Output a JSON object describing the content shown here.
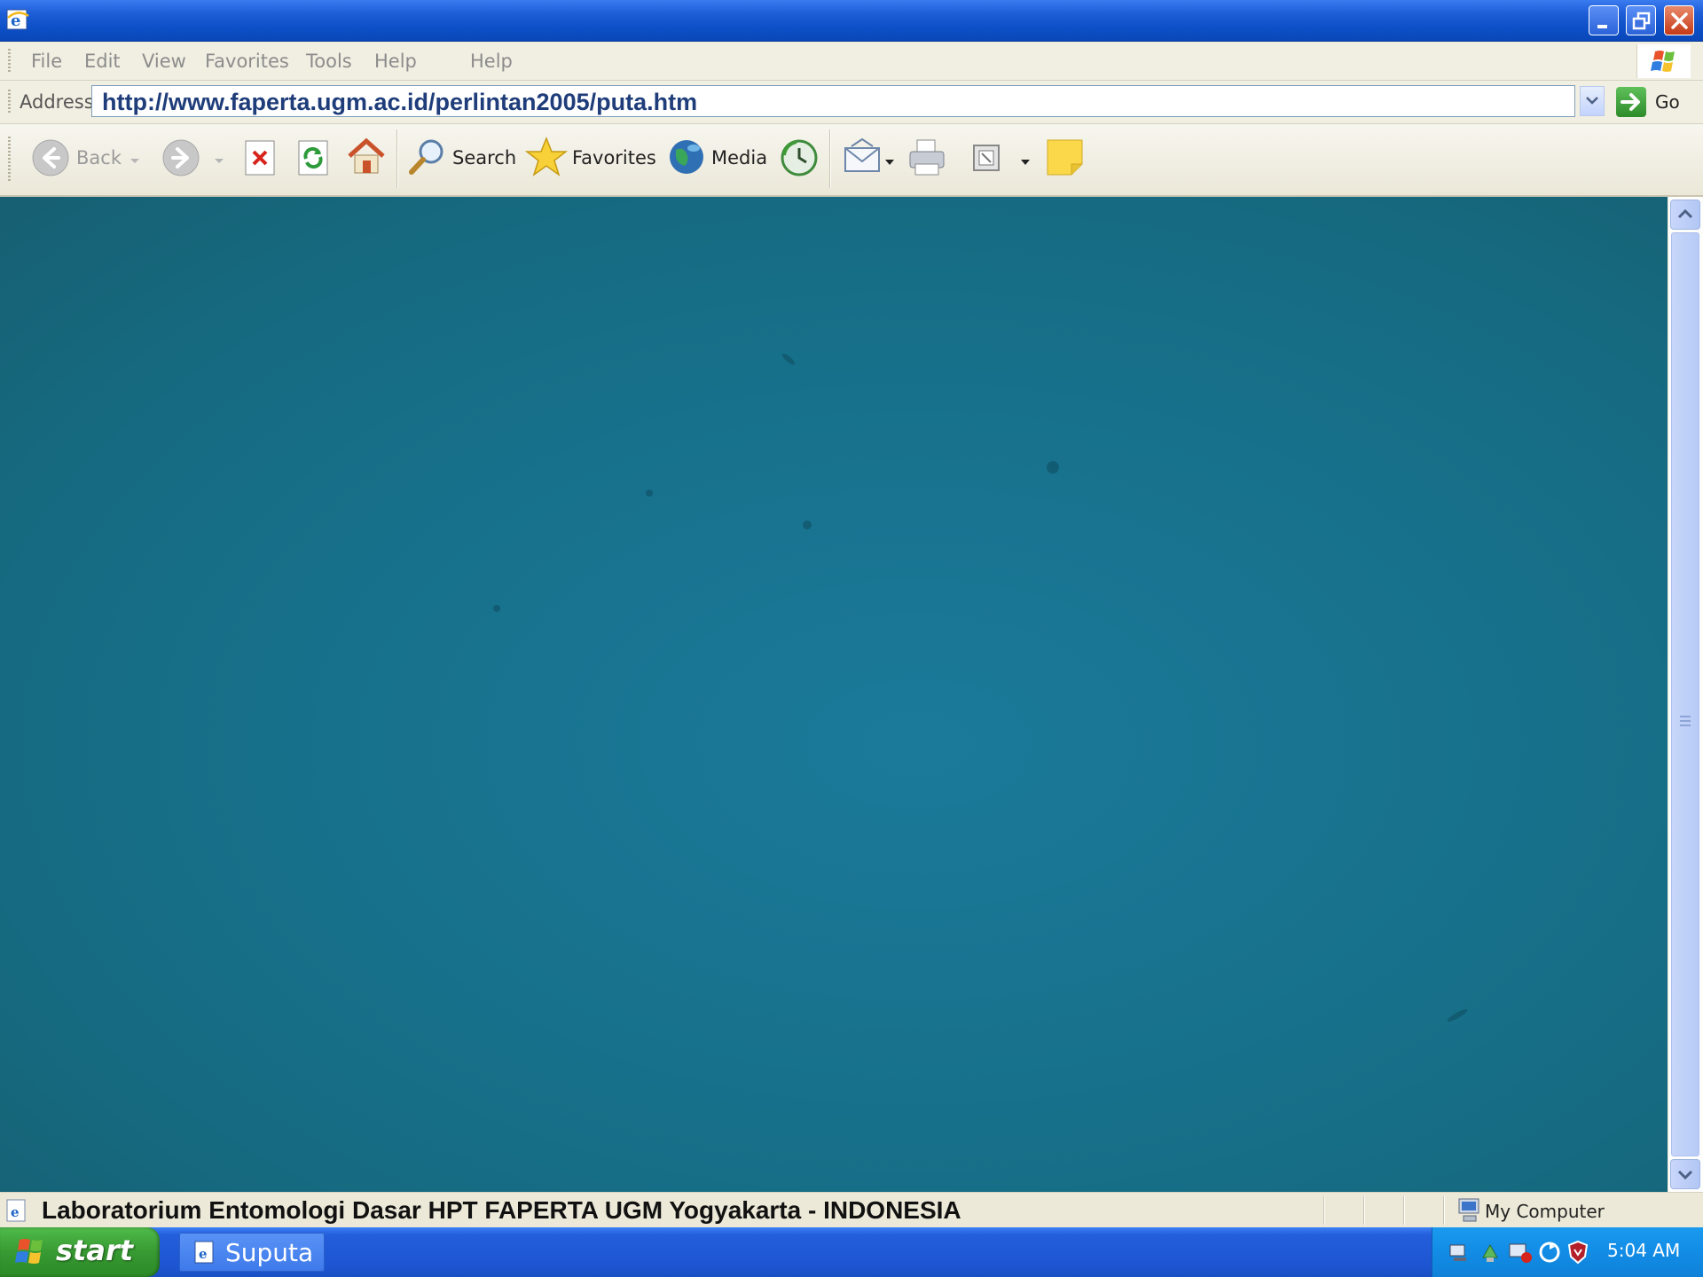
{
  "menu": {
    "items": [
      "File",
      "Edit",
      "View",
      "Favorites",
      "Tools",
      "Help"
    ],
    "extra_help": "Help"
  },
  "address": {
    "label": "Address",
    "url": "http://www.faperta.ugm.ac.id/perlintan2005/puta.htm",
    "go_label": "Go"
  },
  "toolbar": {
    "back_label": "Back",
    "search_label": "Search",
    "favorites_label": "Favorites",
    "media_label": "Media"
  },
  "status": {
    "text": "Laboratorium Entomologi Dasar HPT FAPERTA UGM Yogyakarta - INDONESIA",
    "zone": "My Computer"
  },
  "taskbar": {
    "start_label": "start",
    "task_label": "Suputa",
    "clock": "5:04 AM"
  },
  "colors": {
    "content_background": "#17718c",
    "titlebar": "#0d4fc7",
    "taskbar": "#245edb",
    "start_button": "#379a32"
  }
}
